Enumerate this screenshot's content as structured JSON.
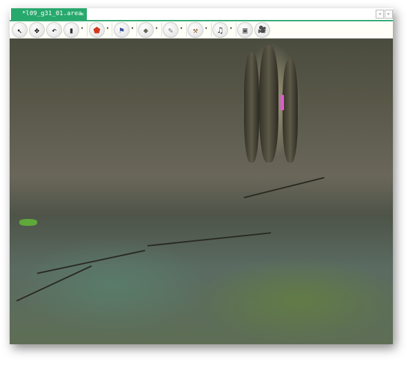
{
  "tab": {
    "title": "*l09_g31_01.area",
    "close": "×"
  },
  "nav": {
    "prev": "◂",
    "next": "▸"
  },
  "toolbar": {
    "tools": [
      {
        "name": "select-tool",
        "icon": "↖"
      },
      {
        "name": "move-tool",
        "icon": "✥"
      },
      {
        "name": "undo-tool",
        "icon": "↶"
      },
      {
        "name": "barrel-tool",
        "icon": "▮"
      },
      {
        "name": "pentagon-tool",
        "icon": "⬟"
      },
      {
        "name": "flag-tool",
        "icon": "⚑"
      },
      {
        "name": "rock-tool",
        "icon": "◆"
      },
      {
        "name": "brush-tool",
        "icon": "✎"
      },
      {
        "name": "axe-tool",
        "icon": "⚒"
      },
      {
        "name": "music-tool",
        "icon": "♫"
      },
      {
        "name": "screen-tool",
        "icon": "▣"
      },
      {
        "name": "movie-camera-tool",
        "icon": "🎥"
      }
    ],
    "dropdown": "▾"
  }
}
